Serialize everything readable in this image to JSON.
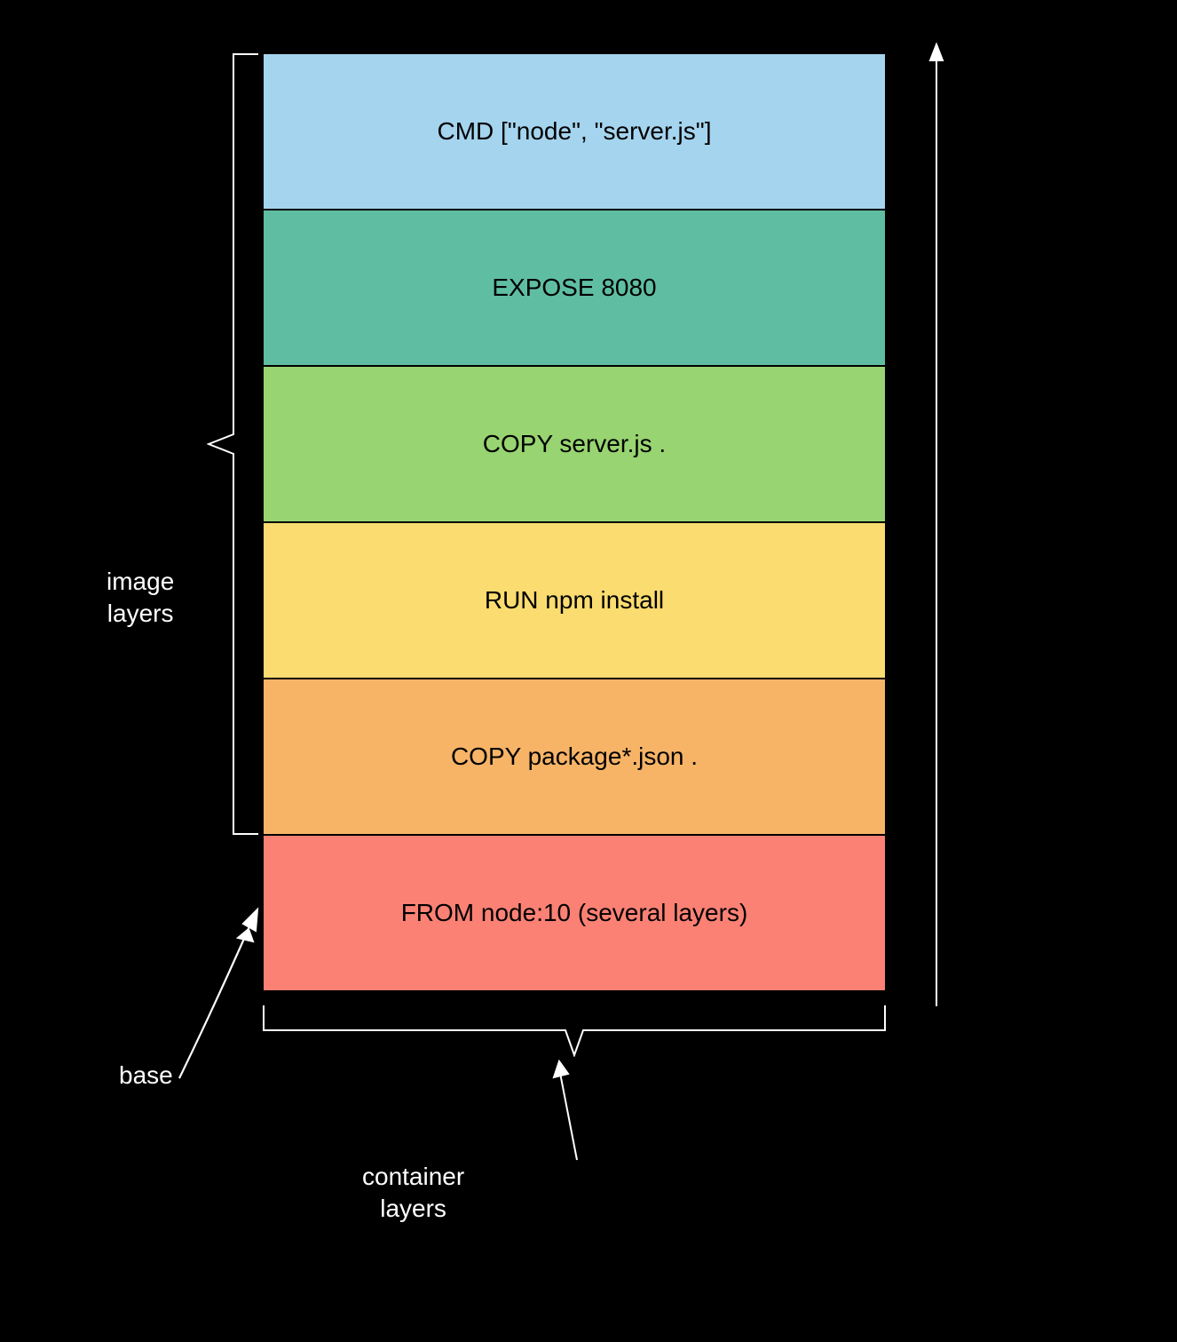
{
  "layers": [
    {
      "label": "FROM node:10 (several layers)",
      "colorClass": "c0"
    },
    {
      "label": "COPY package*.json .",
      "colorClass": "c1"
    },
    {
      "label": "RUN npm install",
      "colorClass": "c2"
    },
    {
      "label": "COPY server.js .",
      "colorClass": "c3"
    },
    {
      "label": "EXPOSE 8080",
      "colorClass": "c4"
    },
    {
      "label": "CMD [\"node\", \"server.js\"]",
      "colorClass": "c5"
    }
  ],
  "captions": {
    "base": "base",
    "image_line1": "image",
    "image_line2": "layers",
    "container_line1": "container",
    "container_line2": "layers"
  }
}
